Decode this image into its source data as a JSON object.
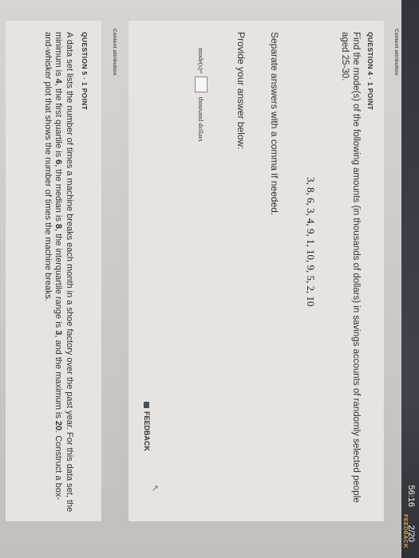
{
  "topbar": {
    "timer": "56:16",
    "counter": "2/20",
    "feedback_label": "FEEDBACK"
  },
  "content_attribution": "Content attribution",
  "question4": {
    "header": "QUESTION 4 · 1 POINT",
    "prompt": "Find the mode(s) of the following amounts (in thousands of dollars) in savings accounts of randomly selected people aged 25-30.",
    "numbers": "3, 8, 6, 3, 4, 9, 1, 10, 9, 5, 2, 10",
    "instruction": "Separate answers with a comma if needed.",
    "provide": "Provide your answer below:",
    "answer_prefix": "mode(s)=",
    "answer_value": "",
    "answer_suffix": "thousand dollars",
    "feedback_label": "FEEDBACK"
  },
  "question5": {
    "header": "QUESTION 5 · 1 POINT",
    "text_parts": [
      "A data set lists the number of times a machine breaks each month in a shoe factory over the past year. For this data set, the minimum is ",
      "4",
      ", the first quartile is ",
      "6",
      ", the median is ",
      "8",
      ", the interquartile range is ",
      "3",
      ", and the maximum is ",
      "20",
      ". Construct a box-and-whisker plot that shows the number of times the machine breaks."
    ]
  },
  "icons": {
    "feedback": "flag-icon",
    "cursor": "pointer-cursor-icon"
  }
}
